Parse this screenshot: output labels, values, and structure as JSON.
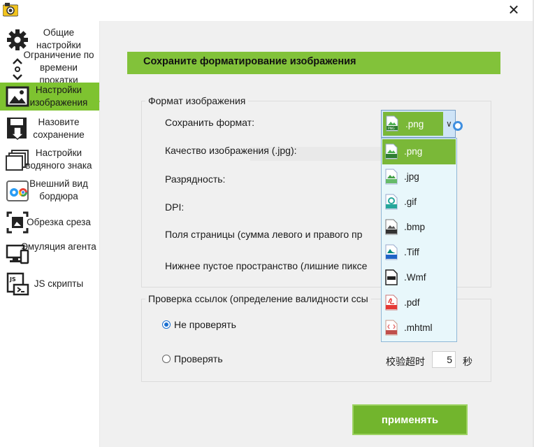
{
  "window": {
    "close_glyph": "✕"
  },
  "sidebar": {
    "items": [
      {
        "label": "Общие настройки",
        "icon": "gear-icon"
      },
      {
        "label": "Ограничение по времени прокатки",
        "icon": "scroll-time-icon"
      },
      {
        "label": "Настройки изображения",
        "icon": "image-icon",
        "active": true
      },
      {
        "label": "Назовите сохранение",
        "icon": "save-icon"
      },
      {
        "label": "Настройки водяного знака",
        "icon": "watermark-icon"
      },
      {
        "label": "Внешний вид бордюра",
        "icon": "browser-frame-icon"
      },
      {
        "label": "Обрезка среза",
        "icon": "crop-icon"
      },
      {
        "label": "Эмуляция агента",
        "icon": "device-emulation-icon"
      },
      {
        "label": "JS скрипты",
        "icon": "js-script-icon"
      }
    ]
  },
  "main": {
    "header_title": "Сохраните форматирование изображения",
    "image_format_group": {
      "legend": "Формат изображения",
      "save_format_label": "Сохранить формат:",
      "quality_label": "Качество изображения (.jpg):",
      "bit_depth_label": "Разрядность:",
      "dpi_label": "DPI:",
      "page_margins_label": "Поля страницы (сумма левого и правого пр",
      "bottom_space_label": "Нижнее пустое пространство (лишние пиксе"
    },
    "link_check_group": {
      "legend": "Проверка ссылок (определение валидности ссы",
      "option_no_check": "Не проверять",
      "option_check": "Проверять",
      "timeout_label": "校验超时",
      "timeout_value": "5",
      "timeout_unit": "秒",
      "selected": "no_check"
    },
    "apply_button": "применять"
  },
  "format_select": {
    "value": ".png",
    "options": [
      ".png",
      ".jpg",
      ".gif",
      ".bmp",
      ".Tiff",
      ".Wmf",
      ".pdf",
      ".mhtml"
    ]
  },
  "colors": {
    "accent": "#7ec330",
    "header": "#82c23a",
    "button": "#72b52d",
    "dropdown_bg": "#e8f7fb"
  }
}
